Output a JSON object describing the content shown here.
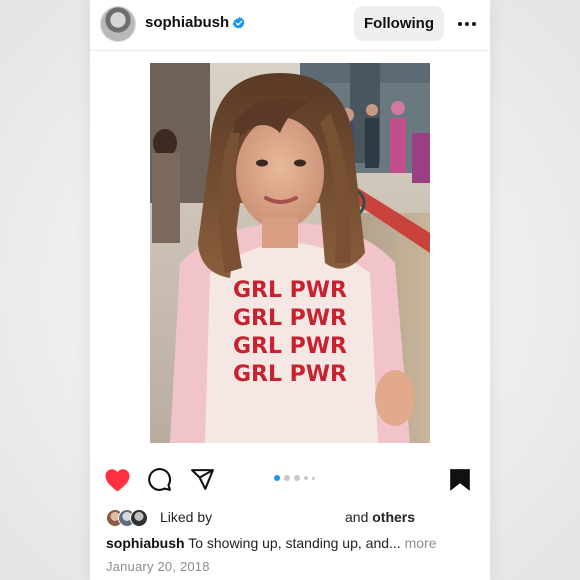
{
  "post": {
    "author": {
      "username": "sophiabush",
      "verified": true
    },
    "follow_button_label": "Following",
    "more_icon": "more-horizontal-icon",
    "photo": {
      "shirt_lines": [
        "GRL PWR",
        "GRL PWR",
        "GRL PWR",
        "GRL PWR"
      ]
    },
    "carousel": {
      "count": 5,
      "active_index": 0
    },
    "likes": {
      "prefix": "Liked by",
      "suffix_and": "and",
      "suffix_others": "others"
    },
    "caption": {
      "username": "sophiabush",
      "text": "To showing up, standing up, and...",
      "more_label": "more"
    },
    "date": "January 20, 2018"
  },
  "colors": {
    "like_red": "#ff3040",
    "carousel_active": "#1c96e8",
    "verified_blue": "#1c96e8",
    "muted_text": "#8e8e8e"
  },
  "icons": {
    "like": "heart-filled-icon",
    "comment": "comment-icon",
    "share": "send-icon",
    "save": "bookmark-filled-icon"
  }
}
